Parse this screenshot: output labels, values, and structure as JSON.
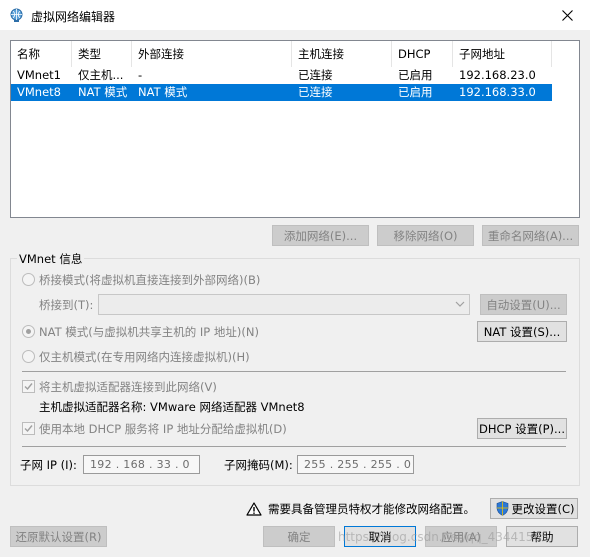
{
  "window": {
    "title": "虚拟网络编辑器",
    "icon": "network-globe-icon"
  },
  "table": {
    "columns": [
      "名称",
      "类型",
      "外部连接",
      "主机连接",
      "DHCP",
      "子网地址"
    ],
    "rows": [
      {
        "name": "VMnet1",
        "type": "仅主机...",
        "external": "-",
        "host": "已连接",
        "dhcp": "已启用",
        "subnet": "192.168.23.0",
        "selected": false
      },
      {
        "name": "VMnet8",
        "type": "NAT 模式",
        "external": "NAT 模式",
        "host": "已连接",
        "dhcp": "已启用",
        "subnet": "192.168.33.0",
        "selected": true
      }
    ]
  },
  "table_buttons": {
    "add": "添加网络(E)...",
    "remove": "移除网络(O)",
    "rename": "重命名网络(A)..."
  },
  "vmnet_info": {
    "label": "VMnet 信息",
    "bridged_label": "桥接模式(将虚拟机直接连接到外部网络)(B)",
    "bridge_to_label": "桥接到(T):",
    "bridge_to_value": "",
    "auto_settings": "自动设置(U)...",
    "nat_label": "NAT 模式(与虚拟机共享主机的 IP 地址)(N)",
    "nat_settings": "NAT 设置(S)...",
    "host_only_label": "仅主机模式(在专用网络内连接虚拟机)(H)",
    "connect_adapter_label": "将主机虚拟适配器连接到此网络(V)",
    "adapter_name_label": "主机虚拟适配器名称: VMware 网络适配器 VMnet8",
    "use_dhcp_label": "使用本地 DHCP 服务将 IP 地址分配给虚拟机(D)",
    "dhcp_settings": "DHCP 设置(P)...",
    "subnet_ip_label": "子网 IP (I):",
    "subnet_ip_value": "192 . 168 . 33 . 0",
    "subnet_mask_label": "子网掩码(M):",
    "subnet_mask_value": "255 . 255 . 255 . 0"
  },
  "admin": {
    "warning_text": "需要具备管理员特权才能修改网络配置。",
    "change_settings": "更改设置(C)"
  },
  "footer": {
    "restore_defaults": "还原默认设置(R)",
    "ok": "确定",
    "cancel": "取消",
    "apply": "应用(A)",
    "help": "帮助",
    "watermark": "https://blog.csdn.net/qq_43441565"
  }
}
